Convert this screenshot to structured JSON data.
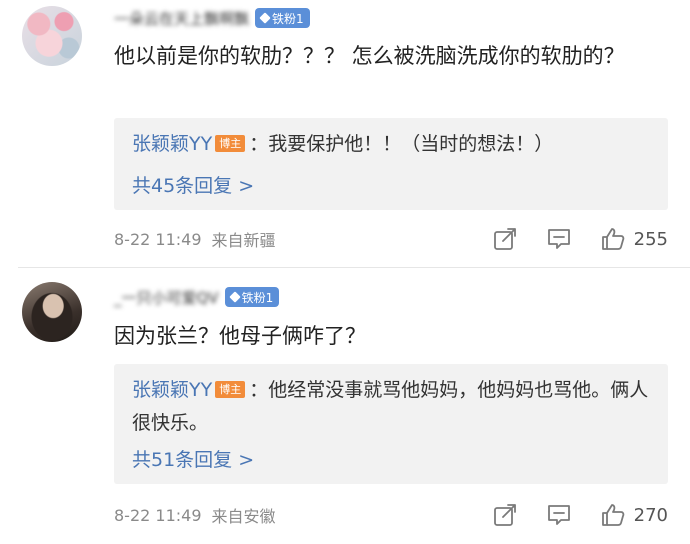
{
  "comments": [
    {
      "username": "一朵云在天上飘啊飘",
      "fan_badge": "铁粉1",
      "text": "他以前是你的软肋？？？ 怎么被洗脑洗成你的软肋的？",
      "reply": {
        "author": "张颖颖YY",
        "author_badge": "博主",
        "text": "：我要保护他！！（当时的想法！）",
        "count_label": "共45条回复 >"
      },
      "time": "8-22 11:49",
      "source": "来自新疆",
      "likes": "255",
      "icons": [
        "share-icon",
        "comment-icon",
        "thumbs-up-icon"
      ]
    },
    {
      "username": "_一只小可爱QV",
      "fan_badge": "铁粉1",
      "text": "因为张兰？他母子俩咋了？",
      "reply": {
        "author": "张颖颖YY",
        "author_badge": "博主",
        "text": "：他经常没事就骂他妈妈，他妈妈也骂他。俩人很快乐。",
        "count_label": "共51条回复 >"
      },
      "time": "8-22 11:49",
      "source": "来自安徽",
      "likes": "270",
      "icons": [
        "share-icon",
        "comment-icon",
        "thumbs-up-icon"
      ]
    }
  ],
  "colors": {
    "link_blue": "#4a76b4",
    "fan_badge": "#5b8fd8",
    "blogger_badge": "#f28c3a",
    "reply_bg": "#f2f2f2",
    "meta_gray": "#8a8a8a"
  }
}
